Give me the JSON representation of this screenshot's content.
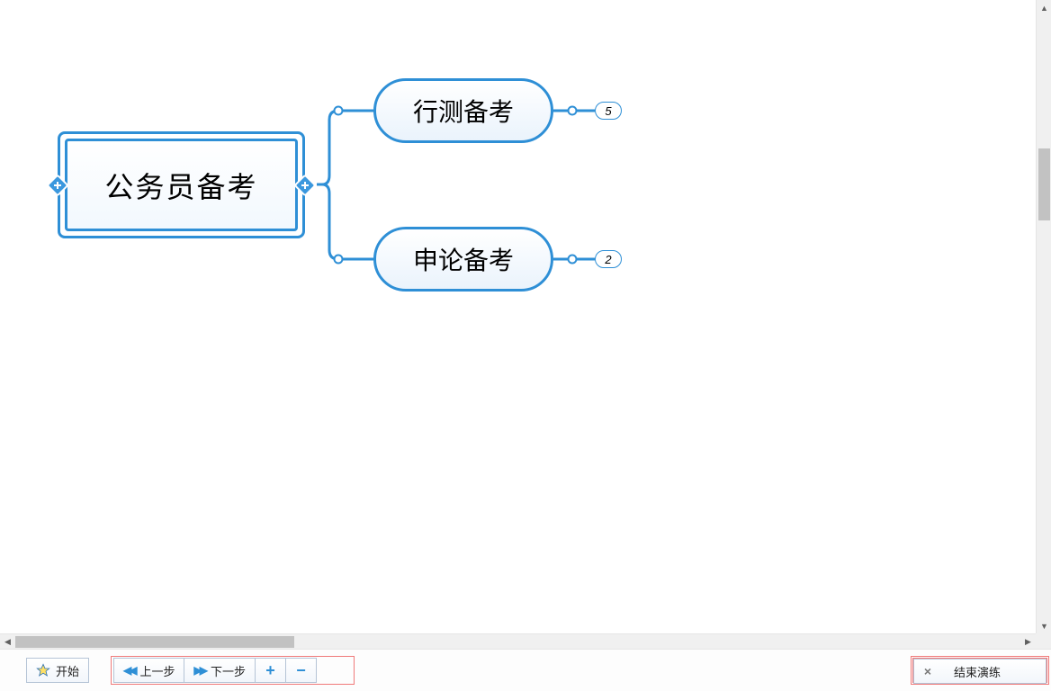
{
  "mindmap": {
    "root": {
      "label": "公务员备考",
      "selected": true
    },
    "children": [
      {
        "label": "行测备考",
        "badge": "5"
      },
      {
        "label": "申论备考",
        "badge": "2"
      }
    ]
  },
  "toolbar": {
    "start_label": "开始",
    "prev_label": "上一步",
    "next_label": "下一步",
    "end_label": "结束演练"
  },
  "colors": {
    "node_border": "#2e8fd6",
    "highlight_box": "#f07a7a"
  }
}
